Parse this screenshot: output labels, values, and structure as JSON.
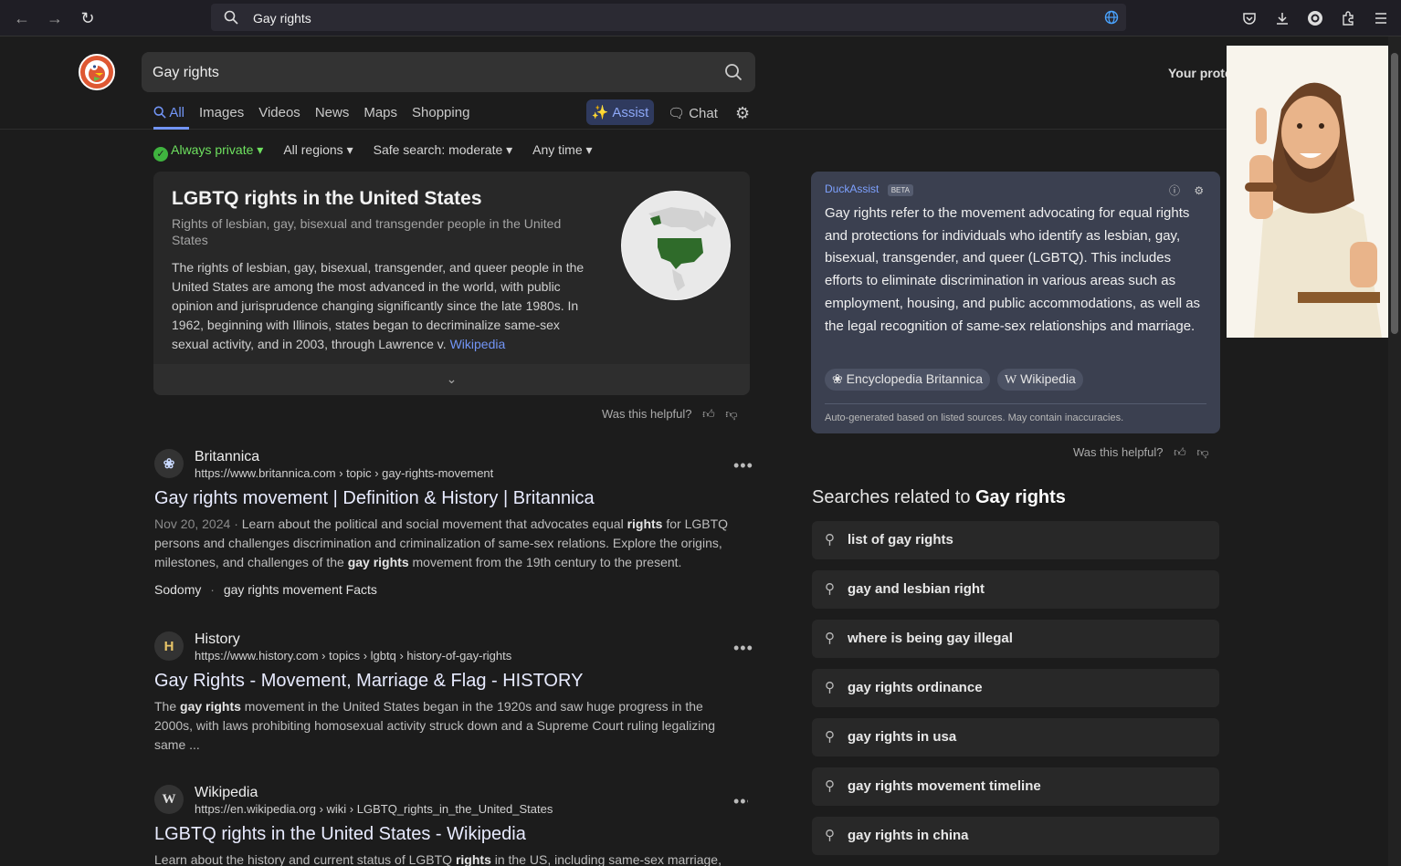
{
  "browser": {
    "url_text": "Gay rights"
  },
  "search": {
    "query": "Gay rights",
    "tabs": [
      "All",
      "Images",
      "Videos",
      "News",
      "Maps",
      "Shopping"
    ],
    "assist_label": "Assist",
    "chat_label": "Chat",
    "protection_text": "Your prote"
  },
  "filters": {
    "privacy": "Always private",
    "region": "All regions",
    "safe_search": "Safe search: moderate",
    "time": "Any time"
  },
  "knowledge_panel": {
    "title": "LGBTQ rights in the United States",
    "subtitle": "Rights of lesbian, gay, bisexual and transgender people in the United States",
    "description": "The rights of lesbian, gay, bisexual, transgender, and queer people in the United States are among the most advanced in the world, with public opinion and jurisprudence changing significantly since the late 1980s. In 1962, beginning with Illinois, states began to decriminalize same-sex sexual activity, and in 2003, through Lawrence v.",
    "source_link": "Wikipedia",
    "helpful": "Was this helpful?"
  },
  "results": [
    {
      "site": "Britannica",
      "url": "https://www.britannica.com › topic › gay-rights-movement",
      "title": "Gay rights movement | Definition & History | Britannica",
      "date": "Nov 20, 2024",
      "snippet_a": "Learn about the political and social movement that advocates equal ",
      "snippet_b": "rights",
      "snippet_c": " for LGBTQ persons and challenges discrimination and criminalization of same-sex relations. Explore the origins, milestones, and challenges of the ",
      "snippet_d": "gay rights",
      "snippet_e": " movement from the 19th century to the present.",
      "link1": "Sodomy",
      "link2": "gay rights movement Facts"
    },
    {
      "site": "History",
      "url": "https://www.history.com › topics › lgbtq › history-of-gay-rights",
      "title": "Gay Rights - Movement, Marriage & Flag - HISTORY",
      "snippet_a": "The ",
      "snippet_b": "gay rights",
      "snippet_c": " movement in the United States began in the 1920s and saw huge progress in the 2000s, with laws prohibiting homosexual activity struck down and a Supreme Court ruling legalizing same ..."
    },
    {
      "site": "Wikipedia",
      "url": "https://en.wikipedia.org › wiki › LGBTQ_rights_in_the_United_States",
      "title": "LGBTQ rights in the United States - Wikipedia",
      "snippet_a": "Learn about the history and current status of LGBTQ ",
      "snippet_b": "rights",
      "snippet_c": " in the US, including same-sex marriage,"
    }
  ],
  "duckassist": {
    "label": "DuckAssist",
    "beta": "BETA",
    "answer": "Gay rights refer to the movement advocating for equal rights and protections for individuals who identify as lesbian, gay, bisexual, transgender, and queer (LGBTQ). This includes efforts to eliminate discrimination in various areas such as employment, housing, and public accommodations, as well as the legal recognition of same-sex relationships and marriage.",
    "sources": [
      "Encyclopedia Britannica",
      "Wikipedia"
    ],
    "note": "Auto-generated based on listed sources. May contain inaccuracies.",
    "helpful": "Was this helpful?"
  },
  "related": {
    "title_prefix": "Searches related to ",
    "title_bold": "Gay rights",
    "items": [
      "list of gay rights",
      "gay and lesbian right",
      "where is being gay illegal",
      "gay rights ordinance",
      "gay rights in usa",
      "gay rights movement timeline",
      "gay rights in china"
    ]
  },
  "colors": {
    "accent": "#7295f6",
    "private_green": "#6ee15f",
    "duck_orange": "#de5833"
  }
}
